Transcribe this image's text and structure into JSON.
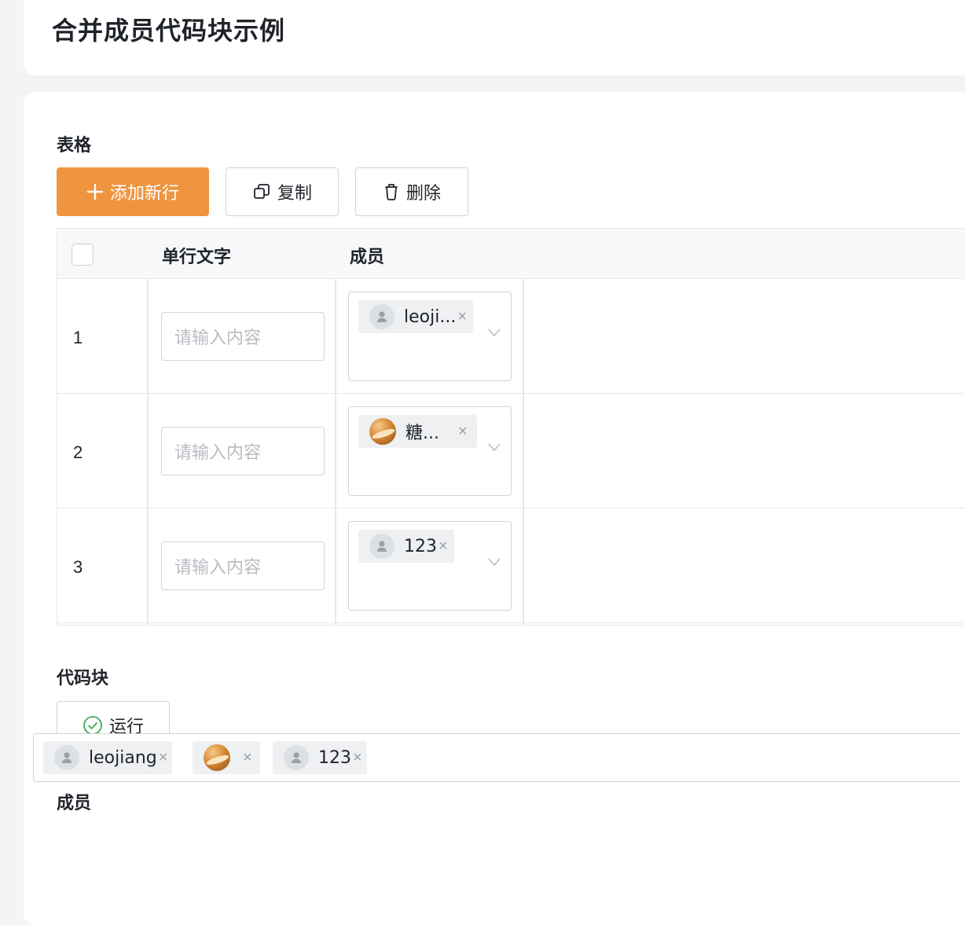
{
  "page": {
    "title": "合并成员代码块示例"
  },
  "table_section": {
    "title": "表格",
    "buttons": {
      "add_row": "添加新行",
      "copy": "复制",
      "delete": "删除"
    },
    "columns": [
      "单行文字",
      "成员"
    ],
    "rows": [
      {
        "index": "1",
        "placeholder": "请输入内容",
        "member": {
          "name": "leoji...",
          "avatar": "default-user-icon"
        }
      },
      {
        "index": "2",
        "placeholder": "请输入内容",
        "member": {
          "name": "糖...",
          "avatar": "photo-avatar"
        }
      },
      {
        "index": "3",
        "placeholder": "请输入内容",
        "member": {
          "name": "123",
          "avatar": "default-user-icon"
        }
      }
    ]
  },
  "code_section": {
    "title": "代码块",
    "run_label": "运行"
  },
  "members_section": {
    "title": "成员",
    "members": [
      {
        "name": "leojiang",
        "avatar": "default-user-icon"
      },
      {
        "name": "",
        "avatar": "photo-avatar"
      },
      {
        "name": "123",
        "avatar": "default-user-icon"
      }
    ]
  },
  "colors": {
    "primary": "#ef9540",
    "border": "#d0d3d6",
    "success_icon": "#3dab5c"
  }
}
